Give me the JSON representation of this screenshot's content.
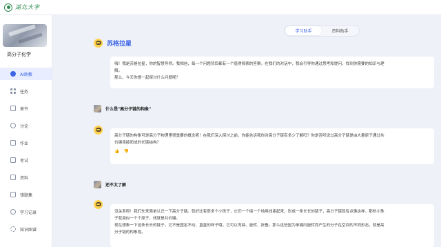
{
  "header": {
    "logo_text": "湖北大学"
  },
  "sidebar": {
    "course_title": "高分子化学",
    "items": [
      {
        "label": "AI助教",
        "icon": "ai-assistant-icon",
        "active": true
      },
      {
        "label": "任务",
        "icon": "task-grid-icon"
      },
      {
        "label": "章节",
        "icon": "chapter-icon"
      },
      {
        "label": "讨论",
        "icon": "discussion-icon"
      },
      {
        "label": "作业",
        "icon": "homework-icon"
      },
      {
        "label": "考试",
        "icon": "exam-icon"
      },
      {
        "label": "资料",
        "icon": "materials-icon"
      },
      {
        "label": "错题集",
        "icon": "mistakes-icon"
      },
      {
        "label": "学习记录",
        "icon": "study-record-icon"
      },
      {
        "label": "知识图谱",
        "icon": "knowledge-graph-icon"
      }
    ]
  },
  "toggle": {
    "study": "学习助手",
    "practice": "资料助手"
  },
  "agent": {
    "name": "苏格拉星"
  },
  "messages": {
    "intro_line1": "嗨！我是苏格拉星，你的智慧导师。我相信，每一个问题背后都有一个值得探索的答案。在我们的对话中，我会引导你通过思考和提问，找到你需要的知识与理",
    "intro_line2": "解。",
    "intro_line3": "那么，今天你想一起探讨什么问题呢？",
    "user1": "什么是\"高分子链的构象\"",
    "reply1_line1": "高分子链的构象可是高分子物理里很重要的概念呢！在我们深入探讨之前，你能告诉我你对高分子链有多少了解吗？你是否听说过高分子链是由大量原子通过共",
    "reply1_line2": "价键连接而成的长链结构？",
    "user2": "还不太了解",
    "reply2_line1": "没关系呀！我们先来简单认识一下高分子链。就好比有很多个小珠子，它们一个接一个地用线串起来，形成一条长长的链子，高分子链就有点像这样，那些小珠",
    "reply2_line2": "子就类似一个个原子，线就是共价键。",
    "reply2_line3": "现在想象一下这条长长的链子，它不是固定不动、直直的样子哦，它可以弯曲、旋转、折叠。那么这些因为单键内旋转而产生的分子在空间的不同形态，就是高",
    "reply2_line4": "分子链的构象啦。"
  }
}
